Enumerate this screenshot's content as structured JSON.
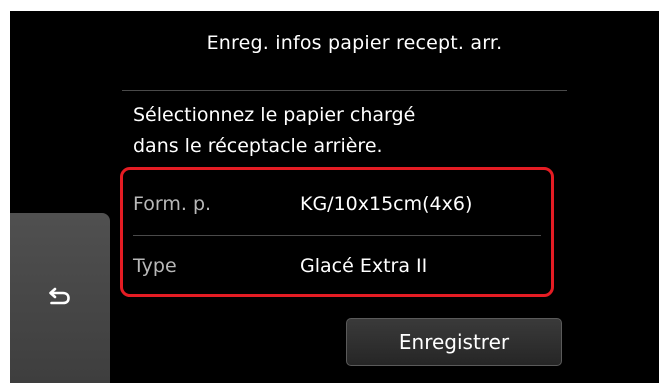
{
  "header": {
    "title": "Enreg. infos papier recept. arr."
  },
  "instruction": {
    "line1": "Sélectionnez le papier chargé",
    "line2": "dans le réceptacle arrière."
  },
  "settings": {
    "paper_size": {
      "label": "Form. p.",
      "value": "KG/10x15cm(4x6)"
    },
    "media_type": {
      "label": "Type",
      "value": "Glacé Extra II"
    }
  },
  "buttons": {
    "back_icon": "back-arrow-icon",
    "register_label": "Enregistrer"
  },
  "colors": {
    "screen_background": "#000000",
    "highlight_border": "#e51c23",
    "label_text": "#b8b8b8",
    "value_text": "#ffffff"
  }
}
